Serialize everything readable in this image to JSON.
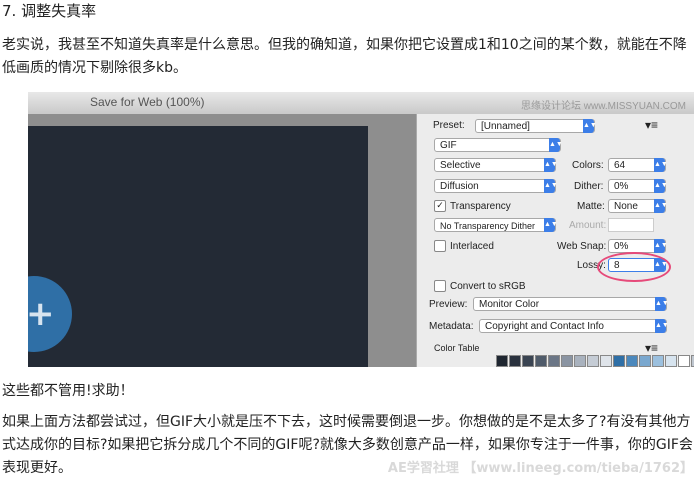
{
  "heading": "7. 调整失真率",
  "para1": "老实说，我甚至不知道失真率是什么意思。但我的确知道，如果你把它设置成1和10之间的某个数，就能在不降低画质的情况下剔除很多kb。",
  "para2": "这些都不管用!求助！",
  "para3": "如果上面方法都尝试过，但GIF大小就是压不下去，这时候需要倒退一步。你想做的是不是太多了?有没有其他方式达成你的目标?如果把它拆分成几个不同的GIF呢?就像大多数创意产品一样，如果你专注于一件事，你的GIF会表现更好。",
  "watermark": "AE学習社理 【www.lineeg.com/tieba/1762】",
  "window": {
    "title": "Save for Web (100%)",
    "site": "思缘设计论坛 www.MISSYUAN.COM"
  },
  "panel": {
    "preset_label": "Preset:",
    "preset_value": "[Unnamed]",
    "format_value": "GIF",
    "reduction_value": "Selective",
    "dither_algo_value": "Diffusion",
    "transparency_label": "Transparency",
    "trans_dither_value": "No Transparency Dither",
    "interlaced_label": "Interlaced",
    "colors_label": "Colors:",
    "colors_value": "64",
    "dither_label": "Dither:",
    "dither_value": "0%",
    "matte_label": "Matte:",
    "matte_value": "None",
    "amount_label": "Amount:",
    "websnap_label": "Web Snap:",
    "websnap_value": "0%",
    "lossy_label": "Lossy:",
    "lossy_value": "8",
    "srgb_label": "Convert to sRGB",
    "preview_label": "Preview:",
    "preview_value": "Monitor Color",
    "metadata_label": "Metadata:",
    "metadata_value": "Copyright and Contact Info",
    "color_table_label": "Color Table"
  },
  "colors": {
    "accent": "#3c7ee8",
    "highlight_ellipse": "#e64a7a",
    "canvas_bg": "#232a35",
    "circle": "#2f6fa6"
  },
  "swatch_colors": [
    "#1f2630",
    "#2a323e",
    "#3a4452",
    "#4f5b6a",
    "#6b7686",
    "#8a94a2",
    "#a9b2be",
    "#c5ccd5",
    "#dfe4ea",
    "#2f6fa6",
    "#4b88bc",
    "#7aa8cf",
    "#9cc0de",
    "#d7e4ef",
    "#ffffff",
    "#bfc6cf",
    "#5c6776",
    "#101418"
  ]
}
